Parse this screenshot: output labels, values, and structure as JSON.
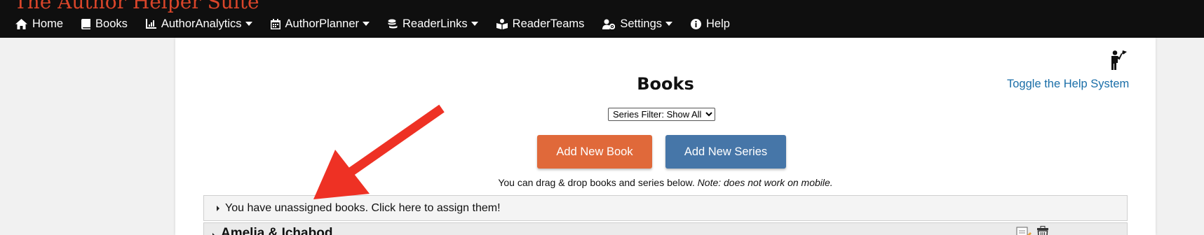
{
  "brand": "The Author Helper Suite",
  "nav": {
    "home": "Home",
    "books": "Books",
    "analytics": "AuthorAnalytics",
    "planner": "AuthorPlanner",
    "readerlinks": "ReaderLinks",
    "readerteams": "ReaderTeams",
    "settings": "Settings",
    "help": "Help"
  },
  "help_toggle": "Toggle the Help System",
  "page_title": "Books",
  "series_filter": {
    "selected": "Series Filter: Show All"
  },
  "buttons": {
    "add_book": "Add New Book",
    "add_series": "Add New Series"
  },
  "hint": {
    "text": "You can drag & drop books and series below. ",
    "note": "Note: does not work on mobile."
  },
  "unassigned": "You have unassigned books. Click here to assign them!",
  "series_rows": [
    {
      "name": "Amelia & Ichabod"
    }
  ],
  "colors": {
    "accent_orange": "#e0693a",
    "accent_blue": "#4676a8",
    "brand_red": "#d9452a",
    "link_blue": "#1a6ea8",
    "arrow_red": "#ee3124"
  }
}
